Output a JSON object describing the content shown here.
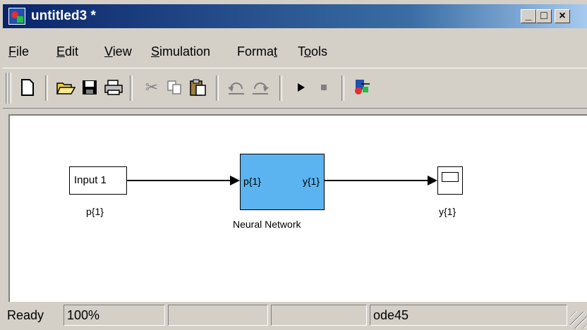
{
  "window": {
    "title": "untitled3 *",
    "title_icon": "simulink-model-icon",
    "controls": [
      "minimize-icon",
      "maximize-icon",
      "close-icon"
    ]
  },
  "menu": [
    {
      "mnemonic": "F",
      "rest": "ile"
    },
    {
      "mnemonic": "E",
      "rest": "dit"
    },
    {
      "mnemonic": "V",
      "rest": "iew"
    },
    {
      "mnemonic": "S",
      "rest": "imulation"
    },
    {
      "pre": "Forma",
      "mnemonic": "t",
      "rest": ""
    },
    {
      "pre": "T",
      "mnemonic": "o",
      "rest": "ols"
    }
  ],
  "toolbar": {
    "buttons": [
      "new-icon",
      "open-icon",
      "save-icon",
      "print-icon",
      "cut-icon",
      "copy-icon",
      "paste-icon",
      "undo-icon",
      "redo-icon",
      "start-simulation-icon",
      "stop-simulation-icon",
      "library-browser-icon"
    ]
  },
  "diagram": {
    "inport": {
      "text": "Input 1",
      "label": "p{1}"
    },
    "neural_network": {
      "input_port": "p{1}",
      "output_port": "y{1}",
      "label": "Neural Network"
    },
    "scope": {
      "label": "y{1}"
    },
    "colors": {
      "nn_fill": "#5bb4f0"
    }
  },
  "status": {
    "state": "Ready",
    "zoom": "100%",
    "blank1": "",
    "blank2": "",
    "solver": "ode45"
  }
}
